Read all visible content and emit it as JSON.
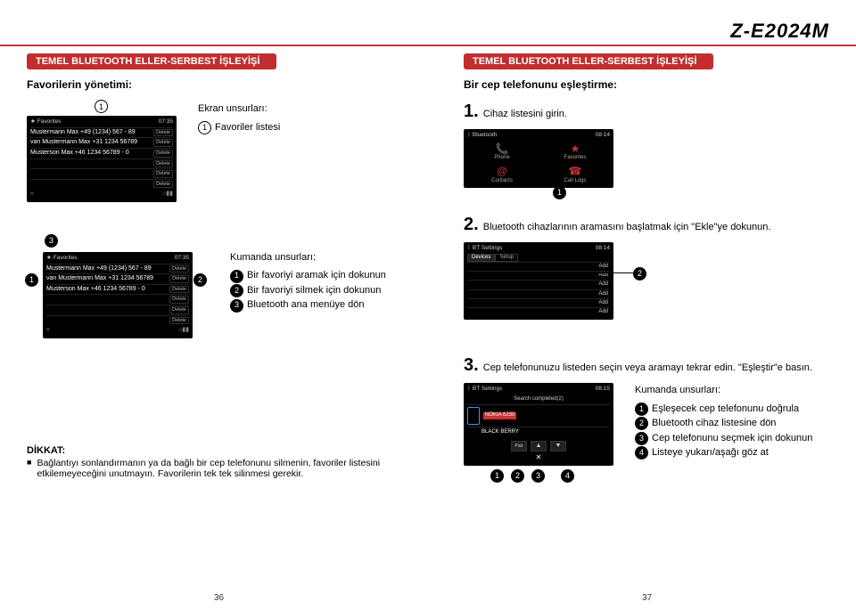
{
  "brand": "Z-E2024M",
  "left_page": {
    "bar": "TEMEL BLUETOOTH ELLER-SERBEST İŞLEYİŞİ",
    "subtitle": "Favorilerin yönetimi:",
    "screen_labels_title": "Ekran unsurları:",
    "screen_label_1": "Favoriler listesi",
    "controls_title": "Kumanda unsurları:",
    "control_1": "Bir favoriyi aramak için dokunun",
    "control_2": "Bir favoriyi silmek için dokunun",
    "control_3": "Bluetooth ana menüye dön",
    "attention_title": "DİKKAT:",
    "attention_body": "Bağlantıyı sonlandırmanın ya da bağlı bir cep telefonunu silmenin, favoriler listesini etkilemeyeceğini unutmayın. Favorilerin tek tek silinmesi gerekir.",
    "page_number": "36"
  },
  "right_page": {
    "bar": "TEMEL BLUETOOTH ELLER-SERBEST İŞLEYİŞİ",
    "subtitle": "Bir cep telefonunu eşleştirme:",
    "step1_num": "1.",
    "step1_text": "Cihaz listesini girin.",
    "step2_num": "2.",
    "step2_text": "Bluetooth cihazlarının aramasını başlatmak için \"Ekle\"ye dokunun.",
    "step3_num": "3.",
    "step3_text": "Cep telefonunuzu listeden seçin veya aramayı tekrar edin. \"Eşleştir\"e basın.",
    "controls_title": "Kumanda unsurları:",
    "c1": "Eşleşecek cep telefonunu doğrula",
    "c2": "Bluetooth cihaz listesine dön",
    "c3": "Cep telefonunu seçmek için dokunun",
    "c4": "Listeye yukarı/aşağı göz at",
    "page_number": "37"
  },
  "favorites_screen": {
    "title": "Favorites",
    "time": "07:35",
    "rows": [
      {
        "name": "Mustermann Max +49 (1234) 567 - 89",
        "del": "Delete"
      },
      {
        "name": "van Mustermann Max +31 1234 56789",
        "del": "Delete"
      },
      {
        "name": "Musterson Max +46 1234 56789 - 0",
        "del": "Delete"
      },
      {
        "name": "",
        "del": "Delete"
      },
      {
        "name": "",
        "del": "Delete"
      },
      {
        "name": "",
        "del": "Delete"
      }
    ],
    "footer": {
      "back": "«",
      "sig": "⌂▮▮"
    }
  },
  "bt_main": {
    "title": "Bluetooth",
    "time": "08:14",
    "tiles": [
      {
        "icon": "📞",
        "label": "Phone"
      },
      {
        "icon": "★",
        "label": "Favorites"
      },
      {
        "icon": "@",
        "label": "Contacts"
      },
      {
        "icon": "☎",
        "label": "Call Logs"
      }
    ]
  },
  "bt_settings": {
    "title": "BT Settings",
    "time": "08:14",
    "tabs": {
      "a": "Devices",
      "b": "Setup"
    },
    "add": "Add"
  },
  "bt_search": {
    "title": "BT Settings",
    "time": "08:15",
    "result_header": "Search completed(2)",
    "rows": [
      "NOKIA 6230",
      "BLACK BERRY"
    ],
    "buttons": {
      "pair": "Pair",
      "x": "✕",
      "up": "▲",
      "down": "▼"
    }
  }
}
